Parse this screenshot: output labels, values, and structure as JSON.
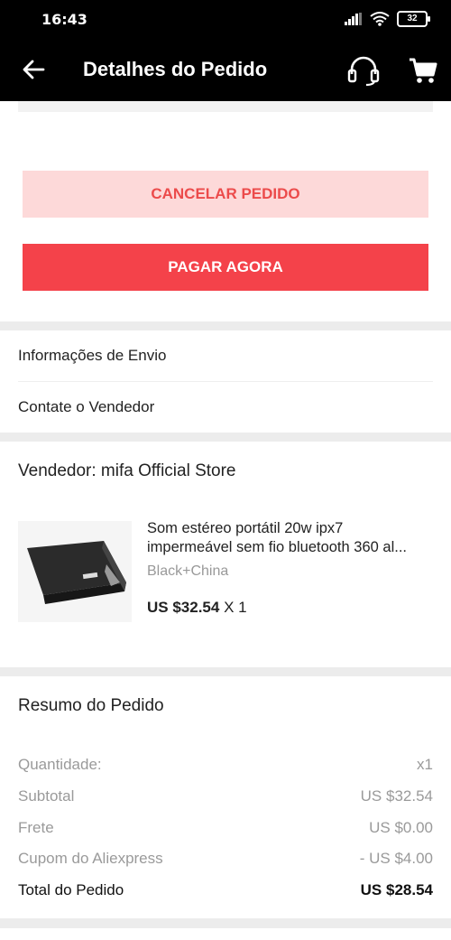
{
  "status_bar": {
    "time": "16:43",
    "battery": "32"
  },
  "header": {
    "title": "Detalhes do Pedido"
  },
  "actions": {
    "cancel_label": "CANCELAR PEDIDO",
    "pay_label": "PAGAR AGORA"
  },
  "links": {
    "shipping_info": "Informações de Envio",
    "contact_seller": "Contate o Vendedor"
  },
  "store": {
    "seller_label": "Vendedor: mifa Official Store",
    "product": {
      "title_line1": "Som estéreo portátil 20w ipx7",
      "title_line2": "impermeável sem fio bluetooth 360 al...",
      "variant": "Black+China",
      "price": "US $32.54",
      "qty": "X 1"
    }
  },
  "summary": {
    "title": "Resumo do Pedido",
    "lines": [
      {
        "label": "Quantidade:",
        "value": "x1"
      },
      {
        "label": "Subtotal",
        "value": "US $32.54"
      },
      {
        "label": "Frete",
        "value": "US $0.00"
      },
      {
        "label": "Cupom do Aliexpress",
        "value": "- US $4.00"
      }
    ],
    "total_label": "Total do Pedido",
    "total_value": "US $28.54"
  },
  "colors": {
    "accent": "#f4424a",
    "cancel_bg": "#fdd9d9",
    "cancel_text": "#ec4b4b"
  }
}
